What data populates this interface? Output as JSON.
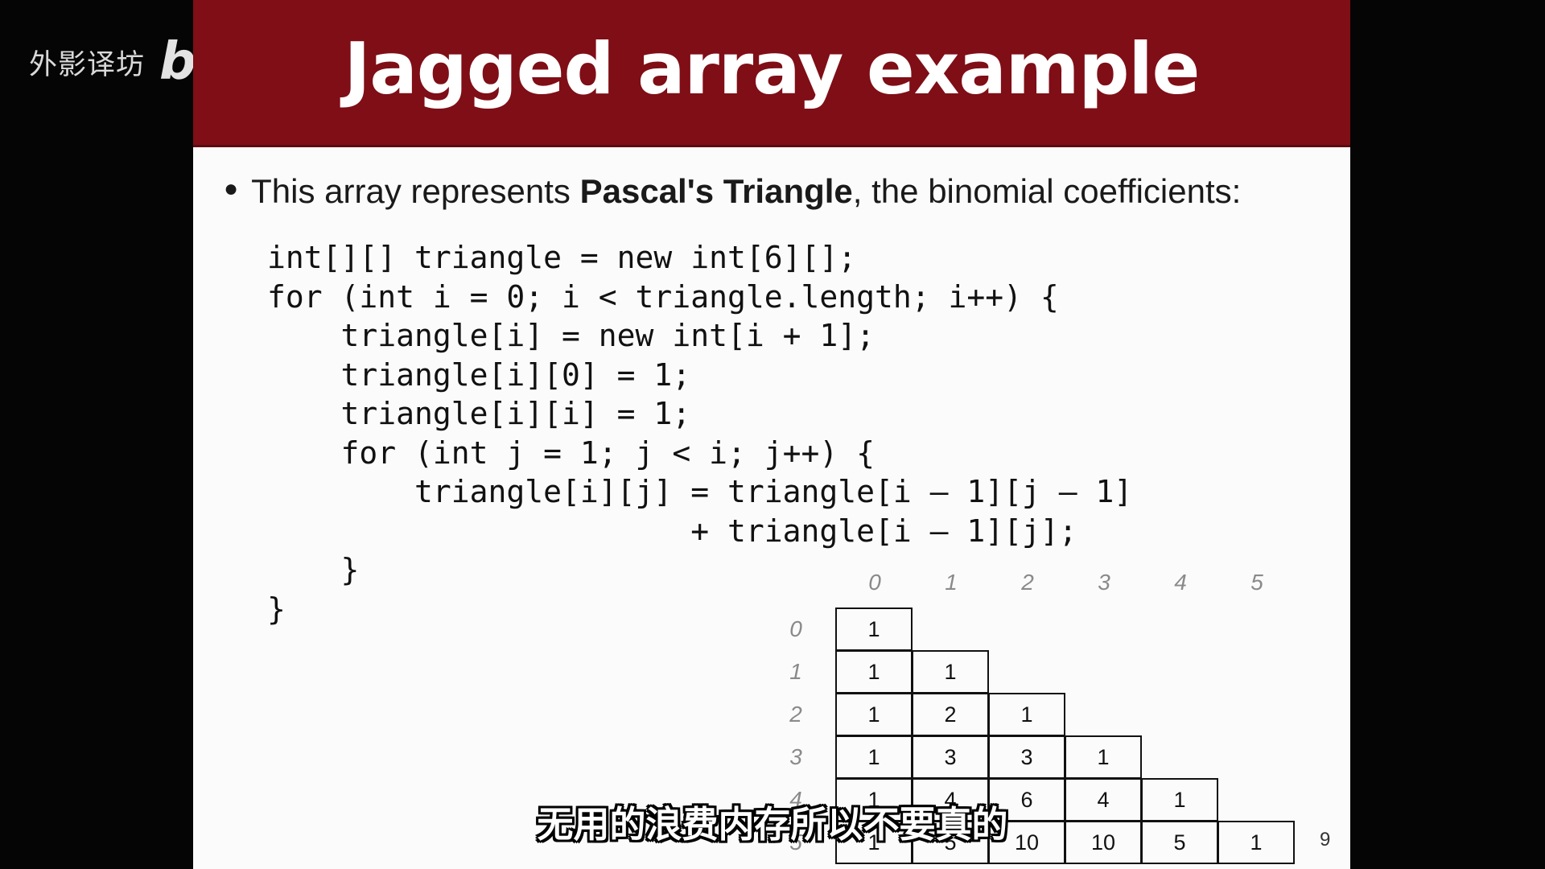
{
  "watermark": {
    "text": "外影译坊",
    "logo": "bilibili"
  },
  "slide": {
    "title": "Jagged array example",
    "bullet": {
      "before": "This array represents ",
      "bold": "Pascal's Triangle",
      "after": ", the binomial coefficients:"
    },
    "code": [
      "int[][] triangle = new int[6][];",
      "for (int i = 0; i < triangle.length; i++) {",
      "    triangle[i] = new int[i + 1];",
      "    triangle[i][0] = 1;",
      "    triangle[i][i] = 1;",
      "    for (int j = 1; j < i; j++) {",
      "        triangle[i][j] = triangle[i – 1][j – 1]",
      "                       + triangle[i – 1][j];",
      "    }",
      "}"
    ],
    "diagram": {
      "column_indices": [
        "0",
        "1",
        "2",
        "3",
        "4",
        "5"
      ],
      "row_indices": [
        "0",
        "1",
        "2",
        "3",
        "4",
        "5"
      ],
      "rows": [
        [
          "1"
        ],
        [
          "1",
          "1"
        ],
        [
          "1",
          "2",
          "1"
        ],
        [
          "1",
          "3",
          "3",
          "1"
        ],
        [
          "1",
          "4",
          "6",
          "4",
          "1"
        ],
        [
          "1",
          "5",
          "10",
          "10",
          "5",
          "1"
        ]
      ],
      "extra_label": "9"
    }
  },
  "subtitle": "无用的浪费内存所以不要真的",
  "colors": {
    "header": "#7f0e16",
    "background": "#050505",
    "slide": "#fbfbfb"
  },
  "icons": {
    "cursor": "mouse-pointer-icon"
  }
}
